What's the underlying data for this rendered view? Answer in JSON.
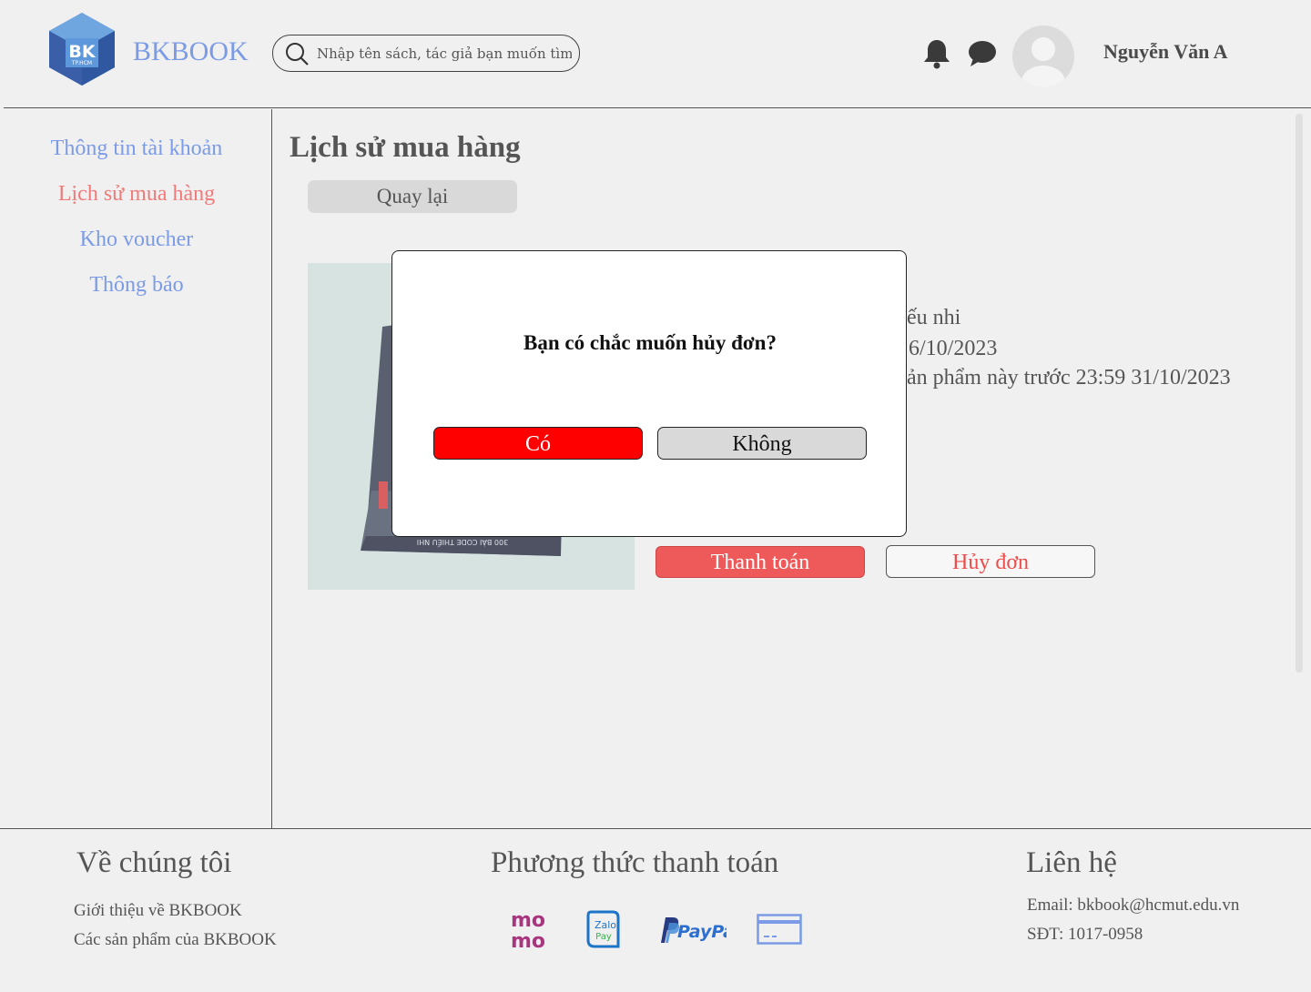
{
  "header": {
    "logo_text": "BK",
    "logo_subtext": "TP.HCM",
    "brand": "BKBOOK",
    "search_placeholder": "Nhập tên sách, tác giả bạn muốn tìm",
    "username": "Nguyễn Văn A"
  },
  "sidebar": {
    "items": [
      {
        "label": "Thông tin tài khoản",
        "active": false
      },
      {
        "label": "Lịch sử mua hàng",
        "active": true
      },
      {
        "label": "Kho voucher",
        "active": false
      },
      {
        "label": "Thông báo",
        "active": false
      }
    ]
  },
  "main": {
    "title": "Lịch sử mua hàng",
    "back_label": "Quay lại",
    "book_spine_text": "300 BÀI CODE THIẾU NHI",
    "info_lines": [
      "ếu nhi",
      "6/10/2023",
      "ản phẩm này trước 23:59 31/10/2023"
    ],
    "pay_label": "Thanh toán",
    "cancel_label": "Hủy đơn"
  },
  "modal": {
    "question": "Bạn có chắc muốn hủy đơn?",
    "yes_label": "Có",
    "no_label": "Không"
  },
  "footer": {
    "about": {
      "heading": "Về chúng tôi",
      "links": [
        "Giới thiệu về BKBOOK",
        "Các sản phẩm của BKBOOK"
      ]
    },
    "payment": {
      "heading": "Phương thức thanh toán",
      "methods": [
        "momo-icon",
        "zalopay-icon",
        "paypal-icon",
        "credit-card-icon"
      ],
      "momo_text": [
        "mo",
        "mo"
      ],
      "zalopay_text": [
        "Zalo",
        "Pay"
      ],
      "paypal_text": "PayPal"
    },
    "contact": {
      "heading": "Liên hệ",
      "email": "Email: bkbook@hcmut.edu.vn",
      "phone": "SĐT:  1017-0958"
    }
  },
  "colors": {
    "brand_blue": "#7b9be6",
    "active_red": "#f07a7a",
    "danger_red": "#ff0000",
    "pay_red": "#ee5a5a"
  }
}
